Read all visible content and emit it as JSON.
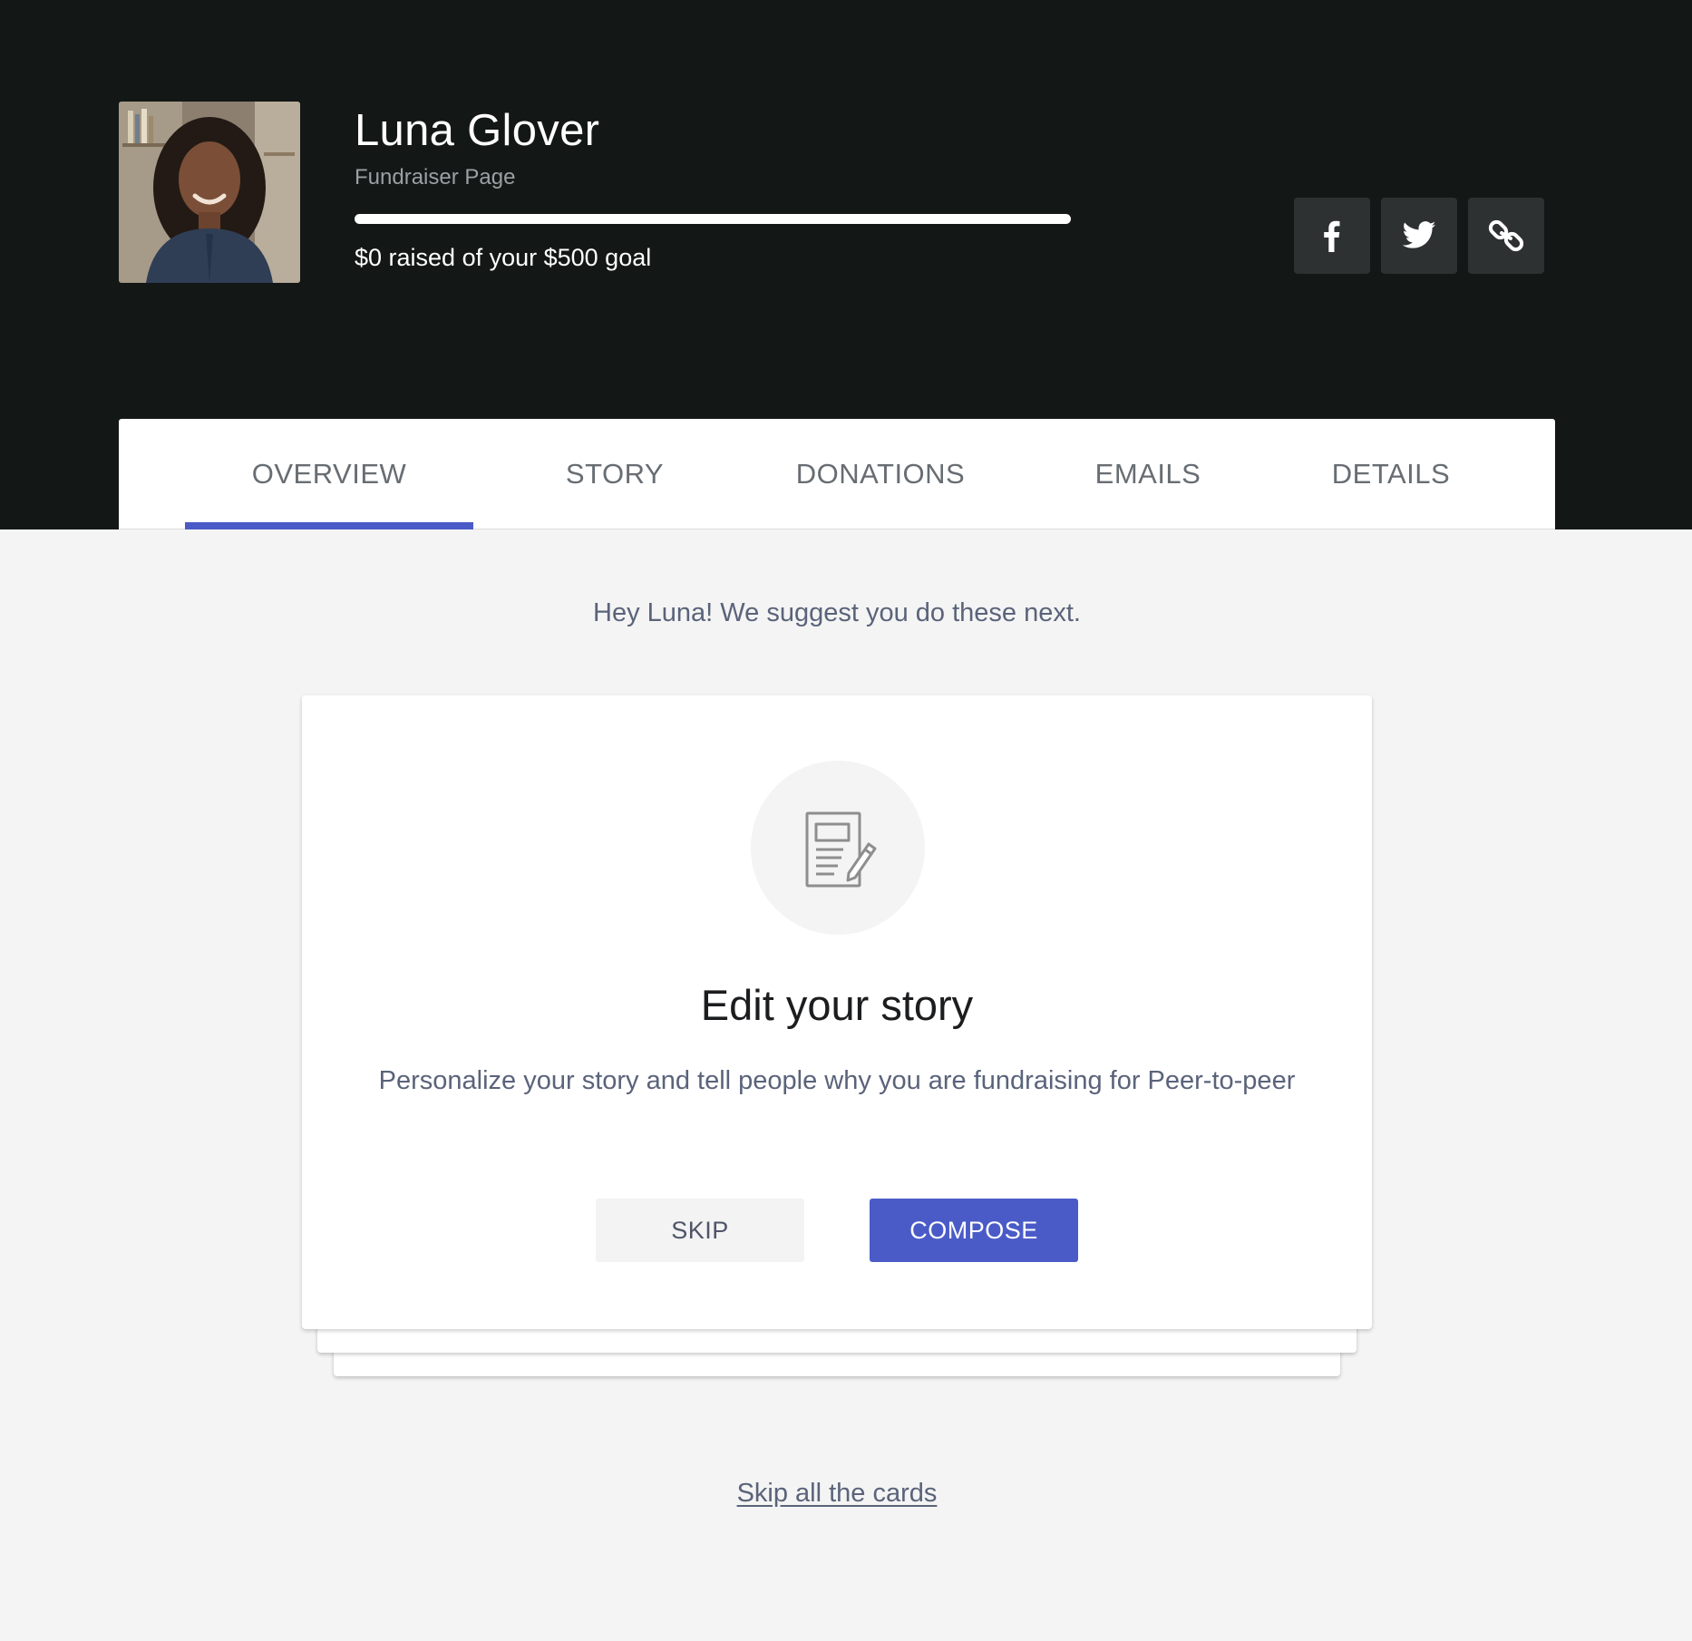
{
  "profile": {
    "name": "Luna Glover",
    "subtitle": "Fundraiser Page",
    "progress_text": "$0 raised of your $500 goal",
    "raised": 0,
    "goal": 500,
    "progress_fraction": 0
  },
  "social": {
    "facebook_icon": "facebook-icon",
    "twitter_icon": "twitter-icon",
    "link_icon": "link-icon"
  },
  "tabs": [
    {
      "label": "OVERVIEW",
      "active": true
    },
    {
      "label": "STORY",
      "active": false
    },
    {
      "label": "DONATIONS",
      "active": false
    },
    {
      "label": "EMAILS",
      "active": false
    },
    {
      "label": "DETAILS",
      "active": false
    }
  ],
  "suggestion": "Hey Luna! We suggest you do these next.",
  "card": {
    "icon": "edit-document-icon",
    "title": "Edit your story",
    "description": "Personalize your story and tell people why you are fundraising for Peer-to-peer",
    "skip_label": "SKIP",
    "compose_label": "COMPOSE"
  },
  "skip_all_label": "Skip all the cards",
  "colors": {
    "header_bg": "#131716",
    "accent": "#4a5bc8",
    "page_bg": "#f4f4f4",
    "social_button_bg": "#2d3132"
  }
}
